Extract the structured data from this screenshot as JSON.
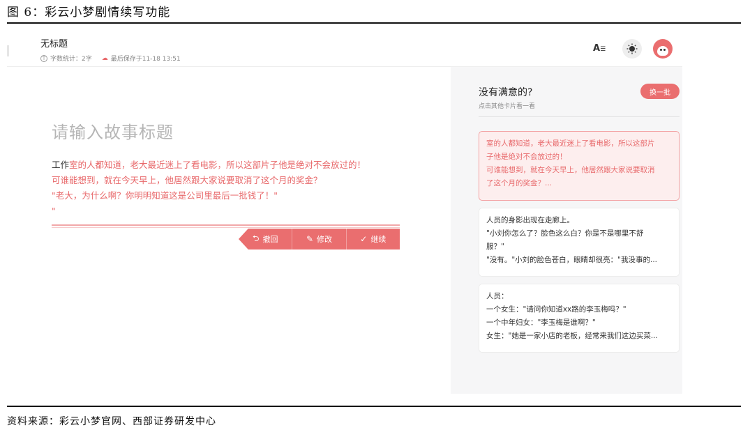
{
  "figure": {
    "caption": "图 6：彩云小梦剧情续写功能",
    "source": "资料来源：彩云小梦官网、西部证券研发中心"
  },
  "header": {
    "doc_title": "无标题",
    "word_count": "字数统计：2字",
    "last_saved": "最后保存于11-18 13:51",
    "font_size_label": "A",
    "icons": [
      "font-size-icon",
      "theme-icon",
      "avatar"
    ]
  },
  "editor": {
    "title_placeholder": "请输入故事标题",
    "lead": "工作",
    "lines": [
      "室的人都知道，老大最近迷上了看电影，所以这部片子他是绝对不会放过的！",
      "可谁能想到，就在今天早上，他居然跟大家说要取消了这个月的奖金？",
      "\"老大，为什么啊？你明明知道这是公司里最后一批钱了！\"",
      "\""
    ],
    "actions": [
      {
        "label": "撤回",
        "icon": "undo-icon"
      },
      {
        "label": "修改",
        "icon": "pen-icon"
      },
      {
        "label": "继续",
        "icon": "check-icon"
      }
    ]
  },
  "panel": {
    "title": "没有满意的?",
    "subtitle": "点击其他卡片看一看",
    "swap_button": "换一批",
    "cards": [
      {
        "lines": [
          "室的人都知道，老大最近迷上了看电影，所以这部片",
          "子他是绝对不会放过的！",
          "可谁能想到，就在今天早上，他居然跟大家说要取消",
          "了这个月的奖金？..."
        ]
      },
      {
        "lines": [
          "人员的身影出现在走廊上。",
          "\"小刘你怎么了？脸色这么白？你是不是哪里不舒",
          "服？\"",
          "\"没有。\"小刘的脸色苍白，眼睛却很亮：\"我没事的..."
        ]
      },
      {
        "lines": [
          "人员：",
          "一个女生：\"请问你知道xx路的李玉梅吗？\"",
          "一个中年妇女：\"李玉梅是谁啊？\"",
          "女生：\"她是一家小店的老板，经常来我们这边买菜..."
        ]
      }
    ]
  },
  "colors": {
    "accent": "#ea6e6f",
    "accent_text": "#e8696b",
    "panel_bg": "#f6f6f7",
    "active_card_bg": "#fdeeee"
  }
}
